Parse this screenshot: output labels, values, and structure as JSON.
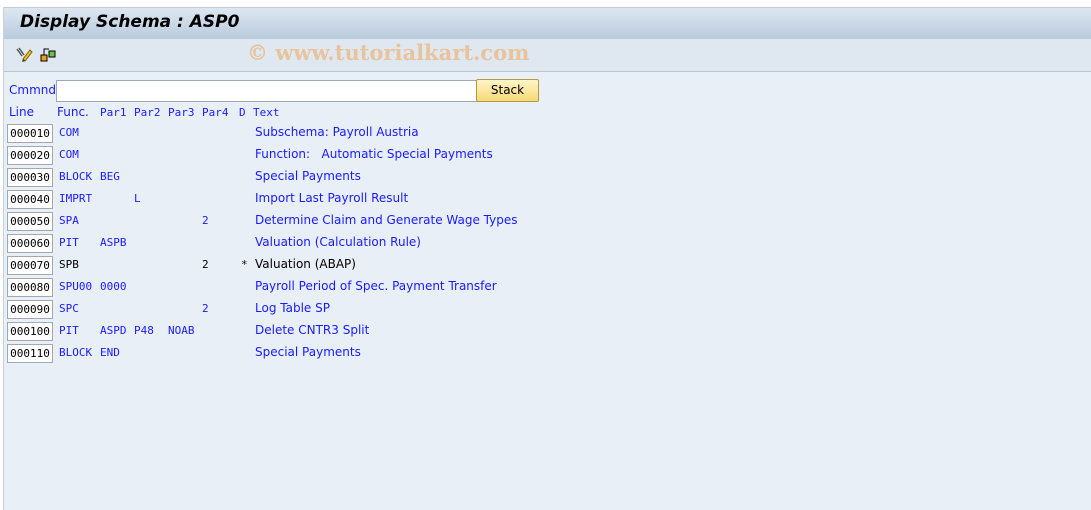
{
  "title": "Display Schema : ASP0",
  "watermark": "© www.tutorialkart.com",
  "toolbar": {
    "icons": [
      "display-change-icon",
      "other-object-icon"
    ]
  },
  "command": {
    "label": "Cmmnd",
    "value": "",
    "stack_label": "Stack"
  },
  "headers": {
    "line": "Line",
    "func": "Func.",
    "par1": "Par1",
    "par2": "Par2",
    "par3": "Par3",
    "par4": "Par4",
    "d": "D",
    "text": "Text"
  },
  "rows": [
    {
      "line": "000010",
      "func": "COM",
      "par1": "",
      "par2": "",
      "par3": "",
      "par4": "",
      "d": "",
      "text": "Subschema: Payroll Austria"
    },
    {
      "line": "000020",
      "func": "COM",
      "par1": "",
      "par2": "",
      "par3": "",
      "par4": "",
      "d": "",
      "text": "Function:   Automatic Special Payments"
    },
    {
      "line": "000030",
      "func": "BLOCK",
      "par1": "BEG",
      "par2": "",
      "par3": "",
      "par4": "",
      "d": "",
      "text": "Special Payments"
    },
    {
      "line": "000040",
      "func": "IMPRT",
      "par1": "",
      "par2": "L",
      "par3": "",
      "par4": "",
      "d": "",
      "text": "Import Last Payroll Result"
    },
    {
      "line": "000050",
      "func": "SPA",
      "par1": "",
      "par2": "",
      "par3": "",
      "par4": "2",
      "d": "",
      "text": "Determine Claim and Generate Wage Types"
    },
    {
      "line": "000060",
      "func": "PIT",
      "par1": "ASPB",
      "par2": "",
      "par3": "",
      "par4": "",
      "d": "",
      "text": "Valuation (Calculation Rule)"
    },
    {
      "line": "000070",
      "func": "SPB",
      "par1": "",
      "par2": "",
      "par3": "",
      "par4": "2",
      "d": "*",
      "text": "Valuation (ABAP)",
      "deactivated": true
    },
    {
      "line": "000080",
      "func": "SPU00",
      "par1": "0000",
      "par2": "",
      "par3": "",
      "par4": "",
      "d": "",
      "text": "Payroll Period of Spec. Payment Transfer"
    },
    {
      "line": "000090",
      "func": "SPC",
      "par1": "",
      "par2": "",
      "par3": "",
      "par4": "2",
      "d": "",
      "text": "Log Table SP"
    },
    {
      "line": "000100",
      "func": "PIT",
      "par1": "ASPD",
      "par2": "P48",
      "par3": "NOAB",
      "par4": "",
      "d": "",
      "text": "Delete CNTR3 Split"
    },
    {
      "line": "000110",
      "func": "BLOCK",
      "par1": "END",
      "par2": "",
      "par3": "",
      "par4": "",
      "d": "",
      "text": "Special Payments"
    }
  ]
}
